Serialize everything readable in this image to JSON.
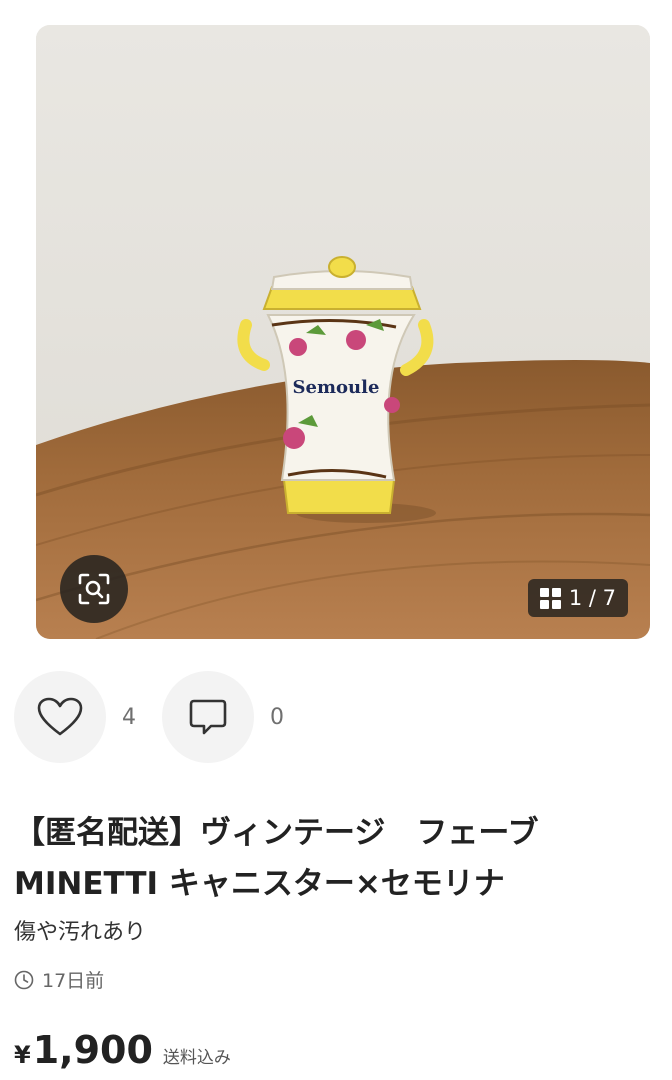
{
  "gallery": {
    "image_alt": "Semoule",
    "jar_label": "Semoule",
    "counter": "1 / 7",
    "zoom_icon": "zoom-scan-icon",
    "grid_icon": "grid-icon"
  },
  "actions": {
    "like_icon": "heart-icon",
    "like_count": "4",
    "comment_icon": "comment-icon",
    "comment_count": "0"
  },
  "item": {
    "title": "【匿名配送】ヴィンテージ　フェーブ MINETTI キャニスター×セモリナ",
    "condition": "傷や汚れあり",
    "posted_ago": "17日前",
    "clock_icon": "clock-icon",
    "currency": "¥",
    "price": "1,900",
    "shipping_note": "送料込み"
  },
  "colors": {
    "accent_dark": "#282420",
    "button_bg": "#f3f3f3",
    "table_wood": "#9c6a3a",
    "jar_yellow": "#f2dd4a"
  }
}
